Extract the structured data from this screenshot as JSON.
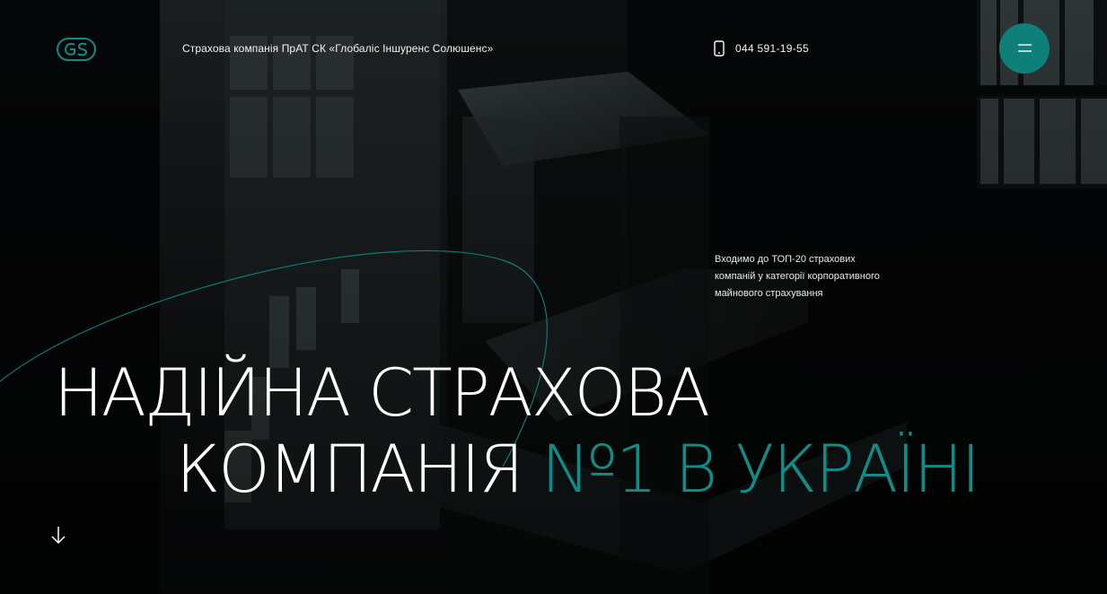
{
  "header": {
    "company_name": "Страхова компанія ПрАТ СК «Глобаліс Іншуренс Солюшенс»",
    "phone": "044 591-19-55",
    "logo_icon": "gs-logo-icon",
    "phone_icon": "mobile-phone-icon",
    "menu_icon": "hamburger-menu-icon"
  },
  "hero": {
    "tagline": "Входимо до ТОП-20 страхових компаній у категорії корпоративного майнового страхування",
    "headline_line1": "НАДІЙНА СТРАХОВА",
    "headline_line2_plain": "КОМПАНІЯ",
    "headline_line2_accent": "№1 В УКРАЇНІ",
    "scroll_icon": "arrow-down-icon"
  },
  "colors": {
    "accent": "#0f8c85",
    "menu_button": "#0f7f79",
    "background": "#050607",
    "text": "#ffffff"
  }
}
